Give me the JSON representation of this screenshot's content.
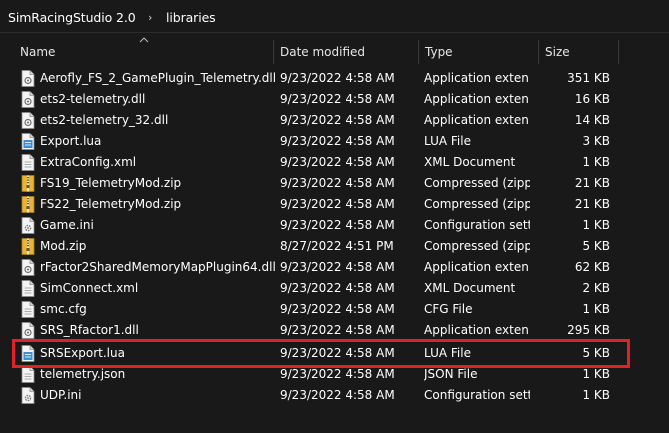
{
  "breadcrumb": {
    "root": "SimRacingStudio 2.0",
    "separator": "›",
    "current": "libraries"
  },
  "columns": {
    "name": "Name",
    "date": "Date modified",
    "type": "Type",
    "size": "Size"
  },
  "colors": {
    "background": "#191919",
    "highlight": "#e0202a",
    "zip_icon": "#e8b431",
    "lua_icon": "#3c8fd6"
  },
  "files": [
    {
      "name": "Aerofly_FS_2_GamePlugin_Telemetry.dll",
      "date": "9/23/2022 4:58 AM",
      "type": "Application exten...",
      "size": "351 KB",
      "icon": "dll-icon"
    },
    {
      "name": "ets2-telemetry.dll",
      "date": "9/23/2022 4:58 AM",
      "type": "Application exten...",
      "size": "16 KB",
      "icon": "dll-icon"
    },
    {
      "name": "ets2-telemetry_32.dll",
      "date": "9/23/2022 4:58 AM",
      "type": "Application exten...",
      "size": "14 KB",
      "icon": "dll-icon"
    },
    {
      "name": "Export.lua",
      "date": "9/23/2022 4:58 AM",
      "type": "LUA File",
      "size": "3 KB",
      "icon": "lua-icon"
    },
    {
      "name": "ExtraConfig.xml",
      "date": "9/23/2022 4:58 AM",
      "type": "XML Document",
      "size": "1 KB",
      "icon": "document-icon"
    },
    {
      "name": "FS19_TelemetryMod.zip",
      "date": "9/23/2022 4:58 AM",
      "type": "Compressed (zipp...",
      "size": "21 KB",
      "icon": "zip-icon"
    },
    {
      "name": "FS22_TelemetryMod.zip",
      "date": "9/23/2022 4:58 AM",
      "type": "Compressed (zipp...",
      "size": "21 KB",
      "icon": "zip-icon"
    },
    {
      "name": "Game.ini",
      "date": "9/23/2022 4:58 AM",
      "type": "Configuration sett...",
      "size": "1 KB",
      "icon": "config-icon"
    },
    {
      "name": "Mod.zip",
      "date": "8/27/2022 4:51 PM",
      "type": "Compressed (zipp...",
      "size": "5 KB",
      "icon": "zip-icon"
    },
    {
      "name": "rFactor2SharedMemoryMapPlugin64.dll",
      "date": "9/23/2022 4:58 AM",
      "type": "Application exten...",
      "size": "62 KB",
      "icon": "dll-icon"
    },
    {
      "name": "SimConnect.xml",
      "date": "9/23/2022 4:58 AM",
      "type": "XML Document",
      "size": "2 KB",
      "icon": "document-icon"
    },
    {
      "name": "smc.cfg",
      "date": "9/23/2022 4:58 AM",
      "type": "CFG File",
      "size": "1 KB",
      "icon": "document-icon"
    },
    {
      "name": "SRS_Rfactor1.dll",
      "date": "9/23/2022 4:58 AM",
      "type": "Application exten...",
      "size": "295 KB",
      "icon": "dll-icon"
    },
    {
      "name": "SRSExport.lua",
      "date": "9/23/2022 4:58 AM",
      "type": "LUA File",
      "size": "5 KB",
      "icon": "lua-icon"
    },
    {
      "name": "telemetry.json",
      "date": "9/23/2022 4:58 AM",
      "type": "JSON File",
      "size": "1 KB",
      "icon": "document-icon"
    },
    {
      "name": "UDP.ini",
      "date": "9/23/2022 4:58 AM",
      "type": "Configuration sett...",
      "size": "1 KB",
      "icon": "config-icon"
    }
  ]
}
